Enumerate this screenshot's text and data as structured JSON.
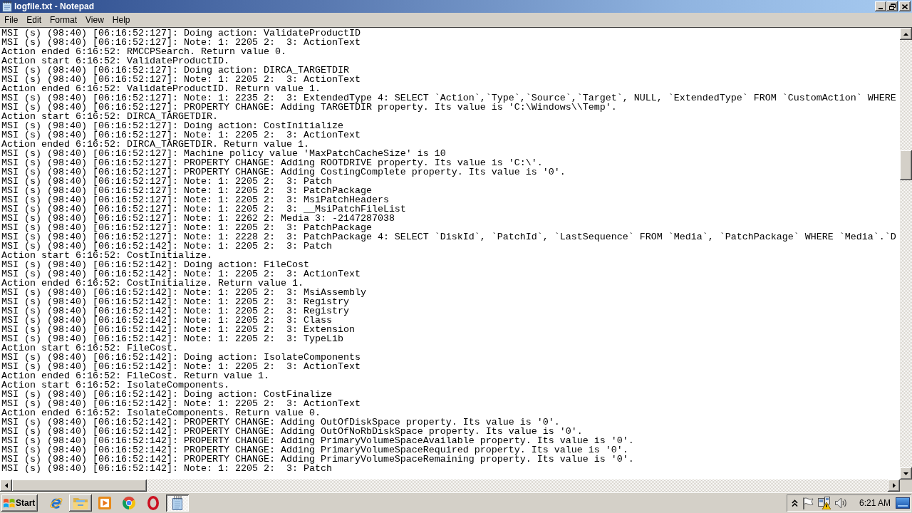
{
  "window": {
    "title": "logfile.txt - Notepad"
  },
  "menu": [
    "File",
    "Edit",
    "Format",
    "View",
    "Help"
  ],
  "editor": {
    "lines": [
      "MSI (s) (98:40) [06:16:52:127]: Doing action: ValidateProductID",
      "MSI (s) (98:40) [06:16:52:127]: Note: 1: 2205 2:  3: ActionText",
      "Action ended 6:16:52: RMCCPSearch. Return value 0.",
      "Action start 6:16:52: ValidateProductID.",
      "MSI (s) (98:40) [06:16:52:127]: Doing action: DIRCA_TARGETDIR",
      "MSI (s) (98:40) [06:16:52:127]: Note: 1: 2205 2:  3: ActionText",
      "Action ended 6:16:52: ValidateProductID. Return value 1.",
      "MSI (s) (98:40) [06:16:52:127]: Note: 1: 2235 2:  3: ExtendedType 4: SELECT `Action`,`Type`,`Source`,`Target`, NULL, `ExtendedType` FROM `CustomAction` WHERE",
      "MSI (s) (98:40) [06:16:52:127]: PROPERTY CHANGE: Adding TARGETDIR property. Its value is 'C:\\Windows\\\\Temp'.",
      "Action start 6:16:52: DIRCA_TARGETDIR.",
      "MSI (s) (98:40) [06:16:52:127]: Doing action: CostInitialize",
      "MSI (s) (98:40) [06:16:52:127]: Note: 1: 2205 2:  3: ActionText",
      "Action ended 6:16:52: DIRCA_TARGETDIR. Return value 1.",
      "MSI (s) (98:40) [06:16:52:127]: Machine policy value 'MaxPatchCacheSize' is 10",
      "MSI (s) (98:40) [06:16:52:127]: PROPERTY CHANGE: Adding ROOTDRIVE property. Its value is 'C:\\'.",
      "MSI (s) (98:40) [06:16:52:127]: PROPERTY CHANGE: Adding CostingComplete property. Its value is '0'.",
      "MSI (s) (98:40) [06:16:52:127]: Note: 1: 2205 2:  3: Patch",
      "MSI (s) (98:40) [06:16:52:127]: Note: 1: 2205 2:  3: PatchPackage",
      "MSI (s) (98:40) [06:16:52:127]: Note: 1: 2205 2:  3: MsiPatchHeaders",
      "MSI (s) (98:40) [06:16:52:127]: Note: 1: 2205 2:  3: __MsiPatchFileList",
      "MSI (s) (98:40) [06:16:52:127]: Note: 1: 2262 2: Media 3: -2147287038",
      "MSI (s) (98:40) [06:16:52:127]: Note: 1: 2205 2:  3: PatchPackage",
      "MSI (s) (98:40) [06:16:52:127]: Note: 1: 2228 2:  3: PatchPackage 4: SELECT `DiskId`, `PatchId`, `LastSequence` FROM `Media`, `PatchPackage` WHERE `Media`.`D",
      "MSI (s) (98:40) [06:16:52:142]: Note: 1: 2205 2:  3: Patch",
      "Action start 6:16:52: CostInitialize.",
      "MSI (s) (98:40) [06:16:52:142]: Doing action: FileCost",
      "MSI (s) (98:40) [06:16:52:142]: Note: 1: 2205 2:  3: ActionText",
      "Action ended 6:16:52: CostInitialize. Return value 1.",
      "MSI (s) (98:40) [06:16:52:142]: Note: 1: 2205 2:  3: MsiAssembly",
      "MSI (s) (98:40) [06:16:52:142]: Note: 1: 2205 2:  3: Registry",
      "MSI (s) (98:40) [06:16:52:142]: Note: 1: 2205 2:  3: Registry",
      "MSI (s) (98:40) [06:16:52:142]: Note: 1: 2205 2:  3: Class",
      "MSI (s) (98:40) [06:16:52:142]: Note: 1: 2205 2:  3: Extension",
      "MSI (s) (98:40) [06:16:52:142]: Note: 1: 2205 2:  3: TypeLib",
      "Action start 6:16:52: FileCost.",
      "MSI (s) (98:40) [06:16:52:142]: Doing action: IsolateComponents",
      "MSI (s) (98:40) [06:16:52:142]: Note: 1: 2205 2:  3: ActionText",
      "Action ended 6:16:52: FileCost. Return value 1.",
      "Action start 6:16:52: IsolateComponents.",
      "MSI (s) (98:40) [06:16:52:142]: Doing action: CostFinalize",
      "MSI (s) (98:40) [06:16:52:142]: Note: 1: 2205 2:  3: ActionText",
      "Action ended 6:16:52: IsolateComponents. Return value 0.",
      "MSI (s) (98:40) [06:16:52:142]: PROPERTY CHANGE: Adding OutOfDiskSpace property. Its value is '0'.",
      "MSI (s) (98:40) [06:16:52:142]: PROPERTY CHANGE: Adding OutOfNoRbDiskSpace property. Its value is '0'.",
      "MSI (s) (98:40) [06:16:52:142]: PROPERTY CHANGE: Adding PrimaryVolumeSpaceAvailable property. Its value is '0'.",
      "MSI (s) (98:40) [06:16:52:142]: PROPERTY CHANGE: Adding PrimaryVolumeSpaceRequired property. Its value is '0'.",
      "MSI (s) (98:40) [06:16:52:142]: PROPERTY CHANGE: Adding PrimaryVolumeSpaceRemaining property. Its value is '0'.",
      "MSI (s) (98:40) [06:16:52:142]: Note: 1: 2205 2:  3: Patch"
    ]
  },
  "taskbar": {
    "start": "Start",
    "apps": [
      {
        "kind": "web",
        "running": false,
        "selected": false
      },
      {
        "kind": "folder",
        "running": true,
        "selected": false
      },
      {
        "kind": "media",
        "running": false,
        "selected": false
      },
      {
        "kind": "chrome",
        "running": false,
        "selected": false
      },
      {
        "kind": "opera",
        "running": false,
        "selected": false
      },
      {
        "kind": "notepad",
        "running": true,
        "selected": true
      }
    ],
    "clock": "6:21 AM"
  }
}
